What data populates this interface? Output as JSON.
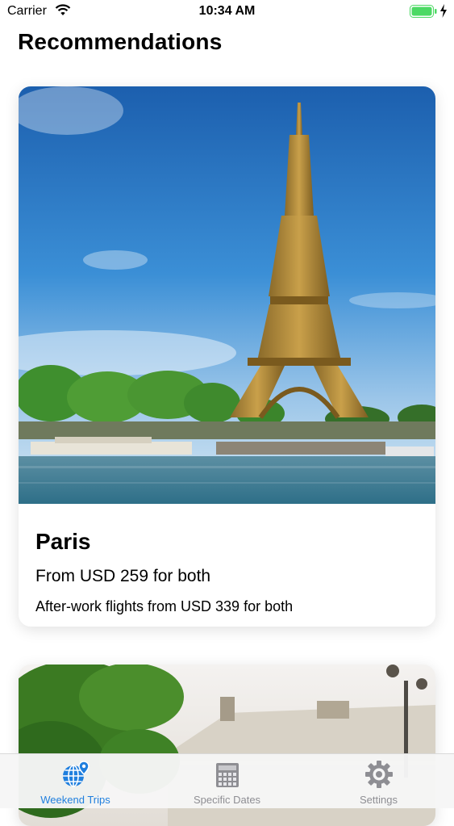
{
  "status_bar": {
    "carrier": "Carrier",
    "time": "10:34 AM"
  },
  "page": {
    "title": "Recommendations"
  },
  "cards": [
    {
      "city": "Paris",
      "price": "From USD 259 for both",
      "note": "After-work flights from USD 339 for both"
    }
  ],
  "tab_bar": {
    "tabs": [
      {
        "label": "Weekend Trips",
        "icon": "globe-pin-icon",
        "active": true
      },
      {
        "label": "Specific Dates",
        "icon": "calendar-icon",
        "active": false
      },
      {
        "label": "Settings",
        "icon": "gear-icon",
        "active": false
      }
    ]
  },
  "colors": {
    "accent": "#1f7fde",
    "inactive": "#8e8e93",
    "battery": "#4cd964"
  }
}
